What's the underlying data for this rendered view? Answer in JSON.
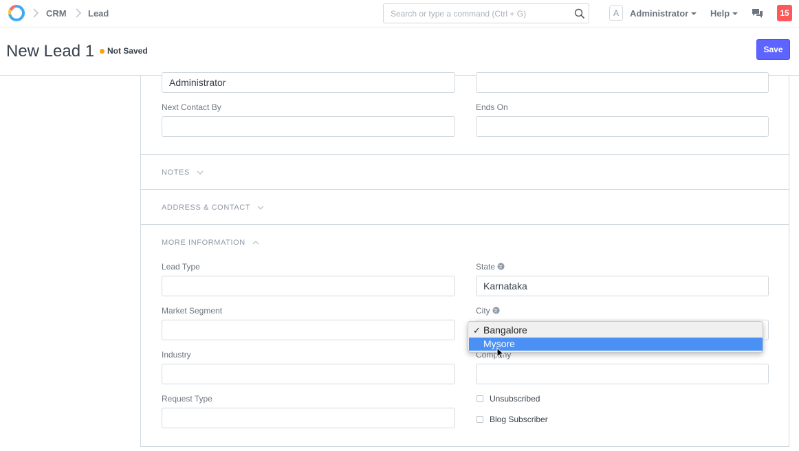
{
  "navbar": {
    "breadcrumbs": [
      "CRM",
      "Lead"
    ],
    "search_placeholder": "Search or type a command (Ctrl + G)",
    "avatar_letter": "A",
    "user_label": "Administrator",
    "help_label": "Help",
    "notification_count": "15"
  },
  "page": {
    "title": "New Lead 1",
    "status": "Not Saved",
    "save_label": "Save"
  },
  "form": {
    "top_left_value": "Administrator",
    "next_contact_by_label": "Next Contact By",
    "ends_on_label": "Ends On",
    "sections": {
      "notes": "NOTES",
      "address": "ADDRESS & CONTACT",
      "more_info": "MORE INFORMATION"
    },
    "lead_type_label": "Lead Type",
    "market_segment_label": "Market Segment",
    "industry_label": "Industry",
    "request_type_label": "Request Type",
    "state_label": "State",
    "state_value": "Karnataka",
    "city_label": "City",
    "company_label": "Company",
    "unsubscribed_label": "Unsubscribed",
    "blog_subscriber_label": "Blog Subscriber"
  },
  "city_dropdown": {
    "options": [
      "Bangalore",
      "Mysore"
    ],
    "selected": "Bangalore",
    "highlighted": "Mysore",
    "check_glyph": "✓"
  },
  "colors": {
    "primary": "#5e64ff",
    "not_saved_dot": "#ffa00a",
    "notification": "#ff5858",
    "dropdown_highlight": "#4a90f5"
  }
}
